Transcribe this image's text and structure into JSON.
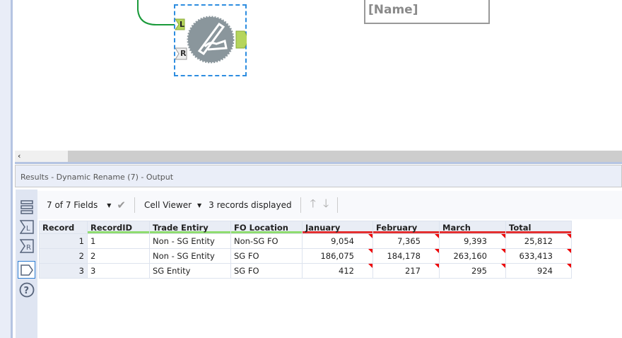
{
  "canvas": {
    "tool_name": "Dynamic Rename",
    "input_left": "L",
    "input_right": "R",
    "text_box": "[Name]"
  },
  "results": {
    "title": "Results - Dynamic Rename (7) - Output"
  },
  "toolbar": {
    "fields": "7 of 7 Fields",
    "viewer": "Cell Viewer",
    "records": "3 records displayed"
  },
  "table": {
    "headers": [
      "Record",
      "RecordID",
      "Trade Entiry",
      "FO Location",
      "January",
      "February",
      "March",
      "Total"
    ],
    "rows": [
      [
        "1",
        "1",
        "Non - SG Entity",
        "Non-SG FO",
        "9,054",
        "7,365",
        "9,393",
        "25,812"
      ],
      [
        "2",
        "2",
        "Non - SG Entity",
        "SG FO",
        "186,075",
        "184,178",
        "263,160",
        "633,413"
      ],
      [
        "3",
        "3",
        "SG Entity",
        "SG FO",
        "412",
        "217",
        "295",
        "924"
      ]
    ]
  },
  "colors": {
    "selection": "#2d8de0",
    "anchor": "#b5d55c",
    "connection": "#1a9a3a",
    "header_string": "#8fdc6f",
    "header_number": "#e43030"
  }
}
